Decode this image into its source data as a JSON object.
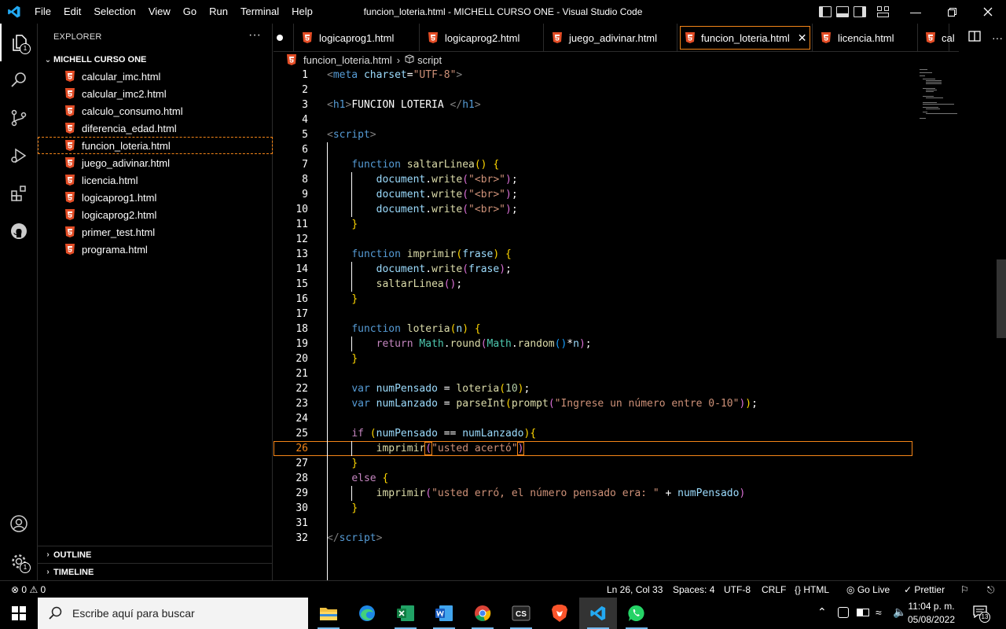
{
  "titlebar": {
    "menu": [
      "File",
      "Edit",
      "Selection",
      "View",
      "Go",
      "Run",
      "Terminal",
      "Help"
    ],
    "window_title": "funcion_loteria.html - MICHELL CURSO ONE - Visual Studio Code"
  },
  "activity": {
    "explorer_badge": "1",
    "settings_badge": "1"
  },
  "sidebar": {
    "title": "EXPLORER",
    "more": "···",
    "folder": "MICHELL CURSO ONE",
    "files": [
      "calcular_imc.html",
      "calcular_imc2.html",
      "calculo_consumo.html",
      "diferencia_edad.html",
      "funcion_loteria.html",
      "juego_adivinar.html",
      "licencia.html",
      "logicaprog1.html",
      "logicaprog2.html",
      "primer_test.html",
      "programa.html"
    ],
    "outline": "OUTLINE",
    "timeline": "TIMELINE"
  },
  "tabs": [
    {
      "label": "logicaprog1.html"
    },
    {
      "label": "logicaprog2.html"
    },
    {
      "label": "juego_adivinar.html"
    },
    {
      "label": "funcion_loteria.html"
    },
    {
      "label": "licencia.html"
    },
    {
      "label": "cal"
    }
  ],
  "breadcrumb": {
    "file": "funcion_loteria.html",
    "symbol": "script"
  },
  "editor": {
    "current_line": 26,
    "line_numbers": [
      "1",
      "2",
      "3",
      "4",
      "5",
      "6",
      "7",
      "8",
      "9",
      "10",
      "11",
      "12",
      "13",
      "14",
      "15",
      "16",
      "17",
      "18",
      "19",
      "20",
      "21",
      "22",
      "23",
      "24",
      "25",
      "26",
      "27",
      "28",
      "29",
      "30",
      "31",
      "32"
    ],
    "code": {
      "meta_charset": "UTF-8",
      "h1_text": "FUNCION LOTERIA ",
      "fn1": "saltarLinea",
      "doc_write": "document",
      "write": "write",
      "br_str": "\"<br>\"",
      "fn2": "imprimir",
      "param": "frase",
      "fn3": "loteria",
      "param_n": "n",
      "return_expr_math": "Math",
      "round": "round",
      "random": "random",
      "var1": "numPensado",
      "num10": "10",
      "var2": "numLanzado",
      "parseInt": "parseInt",
      "prompt": "prompt",
      "prompt_str": "\"Ingrese un número entre 0-10\"",
      "str_ok": "\"usted acertó\"",
      "str_fail": "\"usted erró, el número pensado era: \""
    }
  },
  "statusbar": {
    "errors": "0",
    "warnings": "0",
    "position": "Ln 26, Col 33",
    "spaces": "Spaces: 4",
    "encoding": "UTF-8",
    "eol": "CRLF",
    "language": "HTML",
    "golive": "Go Live",
    "prettier": "Prettier"
  },
  "taskbar": {
    "search_placeholder": "Escribe aquí para buscar",
    "time": "11:04 p. m.",
    "date": "05/08/2022",
    "notifications": "13"
  }
}
